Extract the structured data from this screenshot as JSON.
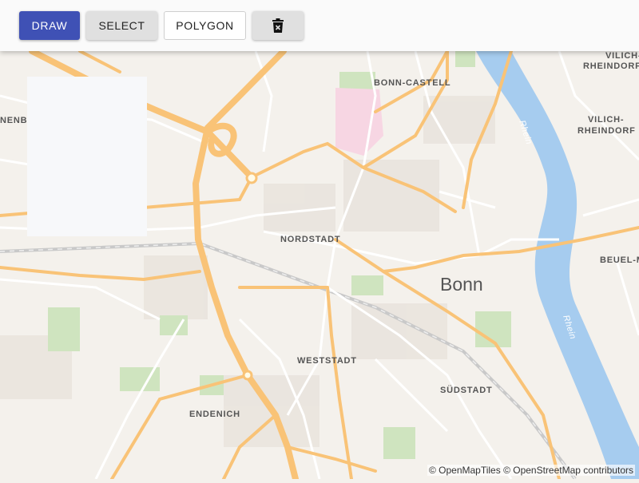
{
  "toolbar": {
    "draw_label": "DRAW",
    "select_label": "SELECT",
    "polygon_label": "POLYGON",
    "delete_icon": "trash-icon"
  },
  "map": {
    "labels": {
      "bonn": "Bonn",
      "bonn_castell": "BONN-CASTELL",
      "nordstadt": "NORDSTADT",
      "weststadt": "WESTSTADT",
      "suedstadt": "SÜDSTADT",
      "endenich": "ENDENICH",
      "vilich_rheindorf_1": "VILICH-",
      "vilich_rheindorf_2": "RHEINDORF",
      "beuel": "BEUEL-M",
      "west_cut": "NENB",
      "rhein": "Rhein"
    },
    "colors": {
      "land": "#f4f1ec",
      "water": "#a6ccef",
      "major_road": "#f9c377",
      "minor_road": "#ffffff",
      "park": "#cfe4bf",
      "hospital": "#f7d6e3"
    }
  },
  "attribution": "© OpenMapTiles © OpenStreetMap contributors"
}
